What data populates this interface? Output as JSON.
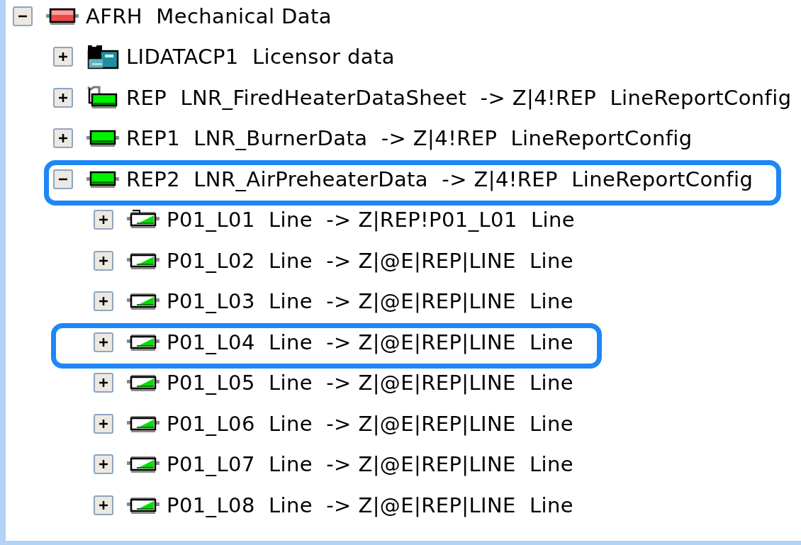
{
  "tree": [
    {
      "label": "AFRH  Mechanical Data",
      "kind": "plate-red",
      "expanded": true,
      "highlighted": false,
      "children": [
        {
          "label": "LIDATACP1  Licensor data",
          "kind": "data",
          "expanded": false,
          "highlighted": false
        },
        {
          "label": "REP  LNR_FiredHeaterDataSheet  -> Z|4!REP  LineReportConfig",
          "kind": "report",
          "expanded": false,
          "highlighted": false
        },
        {
          "label": "REP1  LNR_BurnerData  -> Z|4!REP  LineReportConfig",
          "kind": "plate-green",
          "expanded": false,
          "highlighted": false
        },
        {
          "label": "REP2  LNR_AirPreheaterData  -> Z|4!REP  LineReportConfig",
          "kind": "plate-green",
          "expanded": true,
          "highlighted": true,
          "children": [
            {
              "label": "P01_L01  Line  -> Z|REP!P01_L01  Line",
              "kind": "line-tab",
              "expanded": false,
              "highlighted": false
            },
            {
              "label": "P01_L02  Line  -> Z|@E|REP|LINE  Line",
              "kind": "line",
              "expanded": false,
              "highlighted": false
            },
            {
              "label": "P01_L03  Line  -> Z|@E|REP|LINE  Line",
              "kind": "line",
              "expanded": false,
              "highlighted": false
            },
            {
              "label": "P01_L04  Line  -> Z|@E|REP|LINE  Line",
              "kind": "line",
              "expanded": false,
              "highlighted": true
            },
            {
              "label": "P01_L05  Line  -> Z|@E|REP|LINE  Line",
              "kind": "line",
              "expanded": false,
              "highlighted": false
            },
            {
              "label": "P01_L06  Line  -> Z|@E|REP|LINE  Line",
              "kind": "line",
              "expanded": false,
              "highlighted": false
            },
            {
              "label": "P01_L07  Line  -> Z|@E|REP|LINE  Line",
              "kind": "line",
              "expanded": false,
              "highlighted": false
            },
            {
              "label": "P01_L08  Line  -> Z|@E|REP|LINE  Line",
              "kind": "line",
              "expanded": false,
              "highlighted": false
            }
          ]
        }
      ]
    }
  ]
}
